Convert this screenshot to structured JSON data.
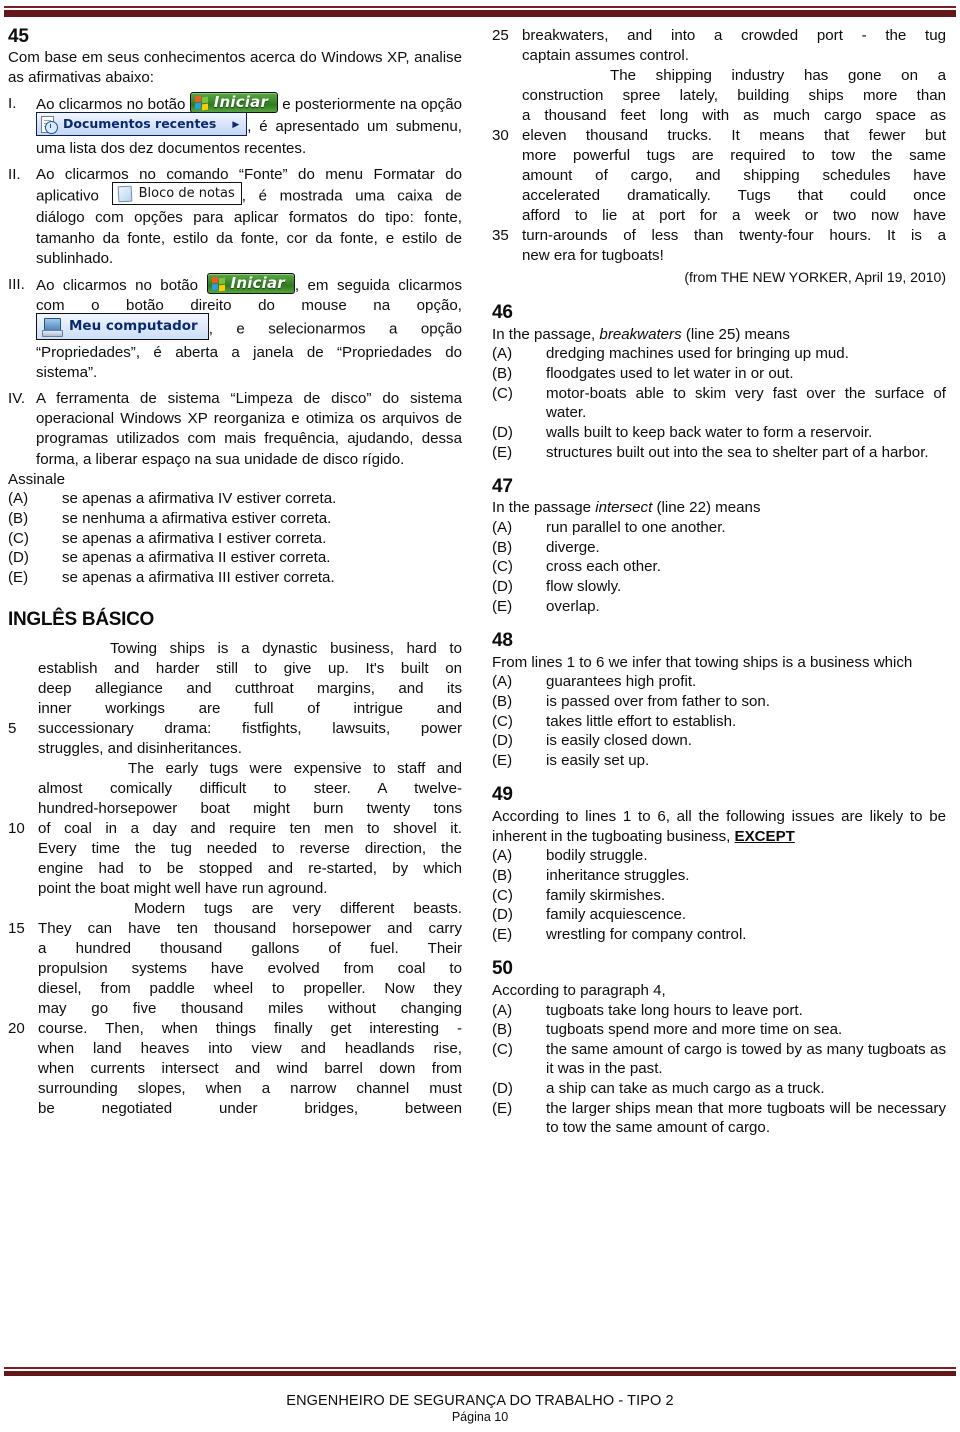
{
  "header": {
    "rule": "double-maroon-rule"
  },
  "footer": {
    "title": "ENGENHEIRO DE SEGURANÇA DO TRABALHO - TIPO 2",
    "page": "Página 10"
  },
  "widgets": {
    "start_button_label": "Iniciar",
    "recent_docs_label": "Documentos recentes",
    "recent_docs_arrow": "▶",
    "notepad_label": "Bloco de notas",
    "my_computer_label": "Meu computador"
  },
  "left_column": {
    "question45": {
      "number": "45",
      "stem": "Com base em seus conhecimentos acerca do Windows XP, analise as afirmativas abaixo:",
      "items": [
        {
          "label": "I.",
          "part1": "Ao clicarmos no botão",
          "part2": "e posteriormente na opção",
          "part3": ", é apresentado um submenu, uma lista dos dez documentos recentes."
        },
        {
          "label": "II.",
          "part1": "Ao clicarmos no comando “Fonte” do menu Formatar do aplicativo",
          "part2": ", é mostrada uma caixa de diálogo com opções para aplicar formatos do tipo: fonte, tamanho da fonte, estilo da fonte, cor da fonte, e estilo de sublinhado."
        },
        {
          "label": "III.",
          "part1": "Ao clicarmos no botão",
          "part2": ", em seguida clicarmos com o botão direito do mouse na opção,",
          "part3": ", e selecionarmos a opção “Propriedades”, é aberta a janela de “Propriedades do sistema”."
        },
        {
          "label": "IV.",
          "part1": "A ferramenta de sistema “Limpeza de disco” do sistema operacional Windows XP reorganiza e otimiza os arquivos de programas utilizados com mais frequência, ajudando, dessa forma, a liberar espaço na sua unidade de disco rígido."
        }
      ],
      "assinale": "Assinale",
      "alternatives": [
        {
          "label": "(A)",
          "text": "se apenas a afirmativa IV estiver correta."
        },
        {
          "label": "(B)",
          "text": "se nenhuma a afirmativa estiver correta."
        },
        {
          "label": "(C)",
          "text": "se apenas a afirmativa I estiver correta."
        },
        {
          "label": "(D)",
          "text": "se apenas a afirmativa II estiver correta."
        },
        {
          "label": "(E)",
          "text": "se apenas a afirmativa III estiver correta."
        }
      ]
    },
    "section_title": "INGLÊS BÁSICO",
    "passage_lines": [
      {
        "num": "",
        "text": "Towing ships is a dynastic business, hard to",
        "indent": true
      },
      {
        "num": "",
        "text": "establish and harder still to give up. It's built on"
      },
      {
        "num": "",
        "text": "deep allegiance and cutthroat margins, and its"
      },
      {
        "num": "",
        "text": "inner workings are full of intrigue and"
      },
      {
        "num": "5",
        "text": "successionary drama: fistfights, lawsuits, power"
      },
      {
        "num": "",
        "text": "struggles, and disinheritances.",
        "last": true
      },
      {
        "num": "",
        "text": "The early tugs were expensive to staff and",
        "indent": true
      },
      {
        "num": "",
        "text": "almost comically difficult to steer. A twelve-"
      },
      {
        "num": "",
        "text": "hundred-horsepower boat might burn twenty tons"
      },
      {
        "num": "10",
        "text": "of coal in a day and require ten men to shovel it."
      },
      {
        "num": "",
        "text": "Every time the tug needed to reverse direction, the"
      },
      {
        "num": "",
        "text": "engine had to be stopped and re-started, by which"
      },
      {
        "num": "",
        "text": "point the boat might well have run aground.",
        "last": true
      },
      {
        "num": "",
        "text": "Modern tugs are very different beasts.",
        "indent": true
      },
      {
        "num": "15",
        "text": "They can have ten thousand horsepower and carry"
      },
      {
        "num": "",
        "text": "a hundred thousand gallons of fuel. Their"
      },
      {
        "num": "",
        "text": "propulsion systems have evolved from coal to"
      },
      {
        "num": "",
        "text": "diesel, from paddle wheel to propeller. Now they"
      },
      {
        "num": "",
        "text": "may go five thousand miles without changing"
      },
      {
        "num": "20",
        "text": "course. Then, when things finally get interesting -"
      },
      {
        "num": "",
        "text": "when land heaves into view and headlands rise,"
      },
      {
        "num": "",
        "text": "when currents intersect and wind barrel down from"
      },
      {
        "num": "",
        "text": "surrounding slopes, when a narrow channel must"
      },
      {
        "num": "",
        "text": "be negotiated under bridges, between"
      }
    ]
  },
  "right_column": {
    "passage_lines": [
      {
        "num": "25",
        "text": "breakwaters, and into a crowded port - the tug"
      },
      {
        "num": "",
        "text": "captain assumes control.",
        "last": true
      },
      {
        "num": "",
        "text": "The shipping industry has gone on a",
        "indent": true
      },
      {
        "num": "",
        "text": "construction spree lately, building ships more than"
      },
      {
        "num": "",
        "text": "a thousand feet long with as much cargo space as"
      },
      {
        "num": "30",
        "text": "eleven thousand trucks. It means that fewer but"
      },
      {
        "num": "",
        "text": "more powerful tugs are required to tow the same"
      },
      {
        "num": "",
        "text": "amount of cargo, and shipping schedules have"
      },
      {
        "num": "",
        "text": "accelerated dramatically. Tugs that could once"
      },
      {
        "num": "",
        "text": "afford to lie at port for a week or two now have"
      },
      {
        "num": "35",
        "text": "turn-arounds of less than twenty-four hours. It is a"
      },
      {
        "num": "",
        "text": "new era for tugboats!",
        "last": true
      }
    ],
    "credit": "(from THE NEW YORKER, April 19, 2010)",
    "questions": [
      {
        "number": "46",
        "stem_pre": "In the passage, ",
        "stem_em": "breakwaters",
        "stem_post": " (line 25) means",
        "alternatives": [
          {
            "label": "(A)",
            "text": "dredging machines used for bringing up mud."
          },
          {
            "label": "(B)",
            "text": "floodgates used to let water in or out."
          },
          {
            "label": "(C)",
            "text": "motor-boats able to skim very fast over the surface of water."
          },
          {
            "label": "(D)",
            "text": "walls built to keep back water to form a reservoir."
          },
          {
            "label": "(E)",
            "text": "structures built out into the sea to shelter part of a harbor."
          }
        ]
      },
      {
        "number": "47",
        "stem_pre": "In the passage ",
        "stem_em": "intersect",
        "stem_post": " (line 22) means",
        "alternatives": [
          {
            "label": "(A)",
            "text": "run parallel to one another."
          },
          {
            "label": "(B)",
            "text": "diverge."
          },
          {
            "label": "(C)",
            "text": "cross each other."
          },
          {
            "label": "(D)",
            "text": "flow slowly."
          },
          {
            "label": "(E)",
            "text": "overlap."
          }
        ]
      },
      {
        "number": "48",
        "stem_pre": "From lines 1 to 6 we infer that towing ships is a business which",
        "stem_em": "",
        "stem_post": "",
        "alternatives": [
          {
            "label": "(A)",
            "text": "guarantees high profit."
          },
          {
            "label": "(B)",
            "text": "is passed over from father to son."
          },
          {
            "label": "(C)",
            "text": "takes little effort to establish."
          },
          {
            "label": "(D)",
            "text": "is easily closed down."
          },
          {
            "label": "(E)",
            "text": "is easily set up."
          }
        ]
      },
      {
        "number": "49",
        "stem_pre": "According to lines 1 to 6, all the following issues are likely to be inherent in the tugboating business, ",
        "stem_u": "EXCEPT",
        "stem_post": "",
        "alternatives": [
          {
            "label": "(A)",
            "text": "bodily struggle."
          },
          {
            "label": "(B)",
            "text": "inheritance struggles."
          },
          {
            "label": "(C)",
            "text": "family skirmishes."
          },
          {
            "label": "(D)",
            "text": "family acquiescence."
          },
          {
            "label": "(E)",
            "text": "wrestling for company control."
          }
        ]
      },
      {
        "number": "50",
        "stem_pre": "According to paragraph 4,",
        "stem_em": "",
        "stem_post": "",
        "alternatives": [
          {
            "label": "(A)",
            "text": "tugboats take long hours to leave port."
          },
          {
            "label": "(B)",
            "text": "tugboats spend more and more time on sea."
          },
          {
            "label": "(C)",
            "text": "the same amount of cargo is towed by as many tugboats as it was in the past."
          },
          {
            "label": "(D)",
            "text": "a ship can take as much cargo as a truck."
          },
          {
            "label": "(E)",
            "text": "the larger ships mean that more tugboats will be necessary to tow the same amount of cargo."
          }
        ]
      }
    ]
  },
  "colors": {
    "rule": "#641719",
    "rule_thin": "#7b1f22",
    "text": "#0d0d0d"
  }
}
